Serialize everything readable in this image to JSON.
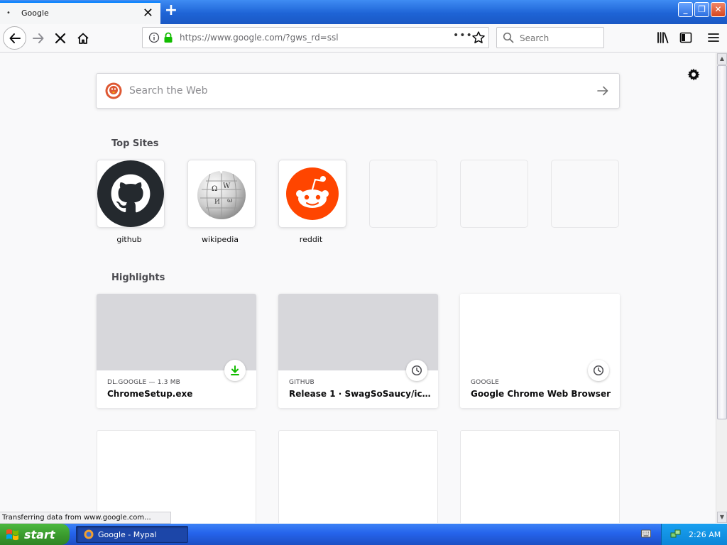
{
  "browser": {
    "tab_title": "Google",
    "tab_loading_glyph": "•",
    "url": "https://www.google.com/?gws_rd=ssl",
    "url_actions_glyph": "•••",
    "search_placeholder": "Search"
  },
  "newtab": {
    "search_placeholder": "Search the Web",
    "top_sites_title": "Top Sites",
    "top_sites": [
      {
        "label": "github"
      },
      {
        "label": "wikipedia"
      },
      {
        "label": "reddit"
      }
    ],
    "highlights_title": "Highlights",
    "highlights": [
      {
        "host": "DL.GOOGLE — 1.3 MB",
        "title": "ChromeSetup.exe",
        "badge_icon": "download-icon"
      },
      {
        "host": "GITHUB",
        "title": "Release 1 · SwagSoSaucy/icon-vi...",
        "badge_icon": "clock-icon"
      },
      {
        "host": "GOOGLE",
        "title": "Google Chrome Web Browser",
        "badge_icon": "clock-icon"
      }
    ]
  },
  "status": {
    "text": "Transferring data from www.google.com..."
  },
  "taskbar": {
    "start_label": "start",
    "task_label": "Google - Mypal",
    "clock": "2:26 AM"
  },
  "colors": {
    "accent": "#0a84ff",
    "lock_green": "#12bc00",
    "reddit": "#ff4500",
    "download_green": "#12bc00",
    "taskbar_blue": "#245edb",
    "start_green": "#3a9a2d"
  }
}
